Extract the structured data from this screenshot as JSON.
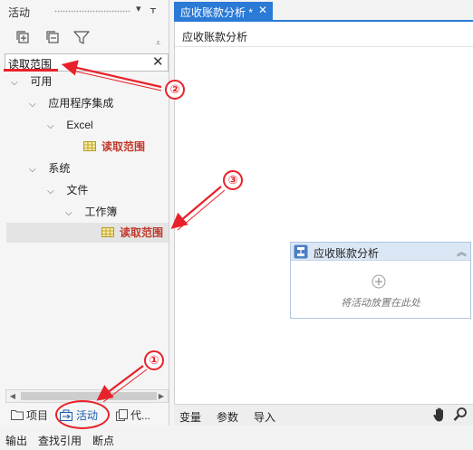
{
  "activities_panel": {
    "title": "活动",
    "search_value": "读取范围",
    "toolbar": {
      "expand_icon": "expand-all-icon",
      "collapse_icon": "collapse-all-icon",
      "filter_icon": "filter-icon"
    },
    "tree": [
      {
        "label": "可用",
        "level": 0,
        "expanded": true
      },
      {
        "label": "应用程序集成",
        "level": 1,
        "expanded": true
      },
      {
        "label": "Excel",
        "level": 2,
        "expanded": true
      },
      {
        "label": "读取范围",
        "level": 3,
        "activity": true
      },
      {
        "label": "系统",
        "level": 1,
        "expanded": true
      },
      {
        "label": "文件",
        "level": 2,
        "expanded": true
      },
      {
        "label": "工作簿",
        "level": 3,
        "expanded": true
      },
      {
        "label": "读取范围",
        "level": 4,
        "activity": true,
        "selected": true
      }
    ],
    "tabs": {
      "project": "项目",
      "activities": "活动",
      "code": "代..."
    }
  },
  "editor": {
    "tab_label": "应收账款分析 *",
    "breadcrumb": "应收账款分析",
    "sequence": {
      "title": "应收账款分析",
      "drop_hint": "将活动放置在此处"
    },
    "bottom_bar": {
      "variables": "变量",
      "arguments": "参数",
      "imports": "导入"
    }
  },
  "status_bar": {
    "output": "输出",
    "find_references": "查找引用",
    "breakpoints": "断点"
  },
  "annotations": {
    "badge_1": "①",
    "badge_2": "②",
    "badge_3": "③",
    "color": "#e8222a"
  },
  "colors": {
    "accent": "#2a7ad6",
    "activity_text": "#c0392b",
    "sequence_header": "#dbe7f5"
  }
}
